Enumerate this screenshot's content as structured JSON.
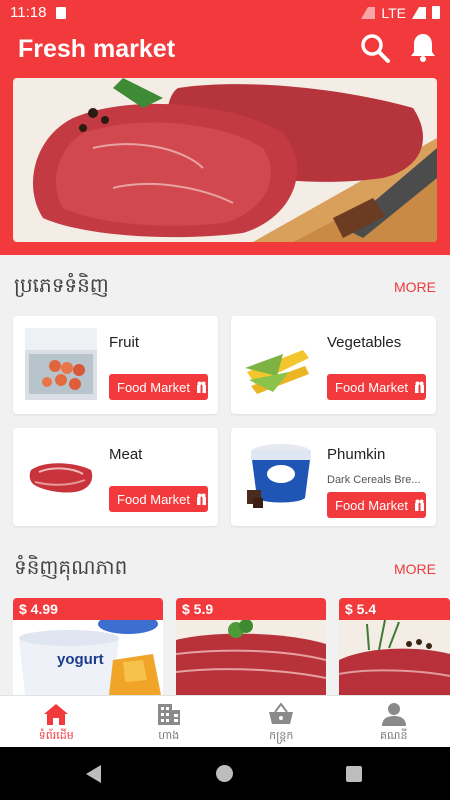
{
  "status_bar": {
    "time": "11:18",
    "network": "LTE"
  },
  "app_bar": {
    "title": "Fresh market"
  },
  "categories_section": {
    "heading": "ប្រភេទទំនិញ",
    "more_label": "MORE",
    "items": [
      {
        "name": "Fruit",
        "subtitle": "",
        "button_label": "Food Market"
      },
      {
        "name": "Vegetables",
        "subtitle": "",
        "button_label": "Food Market"
      },
      {
        "name": "Meat",
        "subtitle": "",
        "button_label": "Food Market"
      },
      {
        "name": "Phumkin",
        "subtitle": "Dark Cereals Bre...",
        "button_label": "Food Market"
      }
    ]
  },
  "quality_section": {
    "heading": "ទំនិញគុណភាព",
    "more_label": "MORE",
    "products": [
      {
        "price": "$ 4.99",
        "image_text": "yogurt"
      },
      {
        "price": "$ 5.9"
      },
      {
        "price": "$ 5.4"
      }
    ]
  },
  "bottom_nav": {
    "items": [
      {
        "label": "ទំព័រដើម",
        "icon": "home-icon",
        "active": true
      },
      {
        "label": "ហាង",
        "icon": "building-icon",
        "active": false
      },
      {
        "label": "កន្ត្រក",
        "icon": "basket-icon",
        "active": false
      },
      {
        "label": "គណនី",
        "icon": "person-icon",
        "active": false
      }
    ]
  },
  "colors": {
    "accent": "#f2393c",
    "background": "#f1f1f1"
  }
}
